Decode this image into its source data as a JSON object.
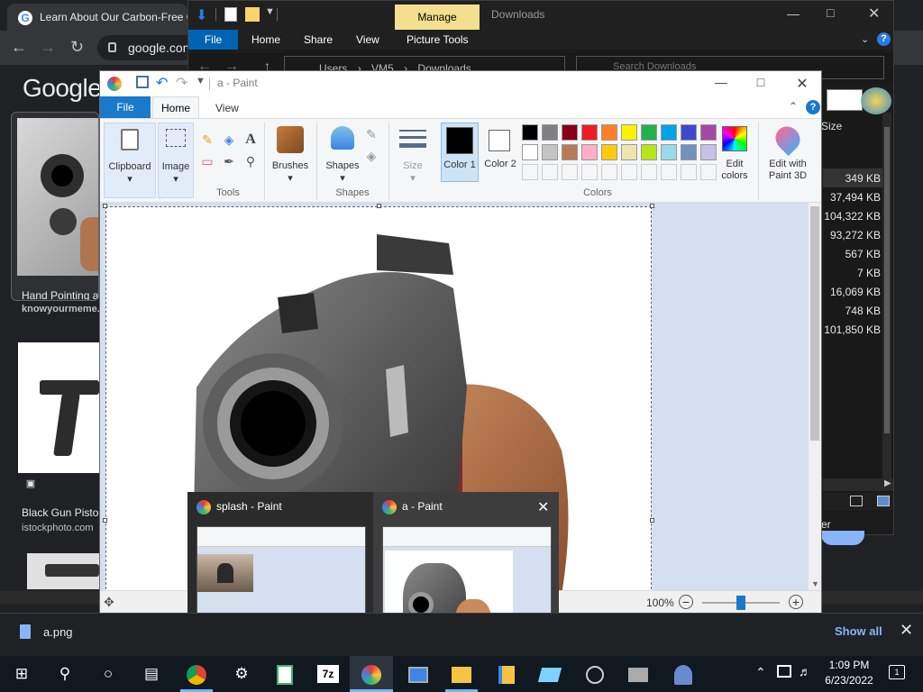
{
  "chrome": {
    "tab_title": "Learn About Our Carbon-Free C",
    "url": "google.com",
    "google_logo": "Google",
    "result1_caption": "Hand Pointing a",
    "result1_source": "knowyourmeme.c",
    "result2_caption": "Black Gun Pisto",
    "result2_source": "istockphoto.com"
  },
  "explorer": {
    "manage_tab": "Manage",
    "window_title": "Downloads",
    "tabs": [
      "File",
      "Home",
      "Share",
      "View",
      "Picture Tools"
    ],
    "address": [
      "Users",
      "VM5",
      "Downloads"
    ],
    "search_placeholder": "Search Downloads",
    "size_header": "Size",
    "sizes": [
      "349 KB",
      "37,494 KB",
      "104,322 KB",
      "93,272 KB",
      "567 KB",
      "7 KB",
      "16,069 KB",
      "748 KB",
      "101,850 KB"
    ],
    "partial_label": "er"
  },
  "paint": {
    "title": "a - Paint",
    "tabs": {
      "file": "File",
      "home": "Home",
      "view": "View"
    },
    "groups": {
      "clipboard": "Clipboard",
      "image": "Image",
      "tools": "Tools",
      "brushes": "Brushes",
      "shapes_btn": "Shapes",
      "shapes_group": "Shapes",
      "size": "Size",
      "colors": "Colors"
    },
    "color1": "Color 1",
    "color2": "Color 2",
    "edit_colors": "Edit colors",
    "edit_paint3d": "Edit with Paint 3D",
    "zoom": "100%",
    "palette": [
      "#000000",
      "#7f7f7f",
      "#880015",
      "#ed1c24",
      "#ff7f27",
      "#fff200",
      "#22b14c",
      "#00a2e8",
      "#3f48cc",
      "#a349a4",
      "#ffffff",
      "#c3c3c3",
      "#b97a57",
      "#ffaec9",
      "#ffc90e",
      "#efe4b0",
      "#b5e61d",
      "#99d9ea",
      "#7092be",
      "#c8bfe7"
    ]
  },
  "thumbnails": [
    {
      "title": "splash - Paint"
    },
    {
      "title": "a - Paint"
    }
  ],
  "download_bar": {
    "file": "a.png",
    "show_all": "Show all"
  },
  "taskbar": {
    "time": "1:09 PM",
    "date": "6/23/2022",
    "notifications": "1"
  }
}
